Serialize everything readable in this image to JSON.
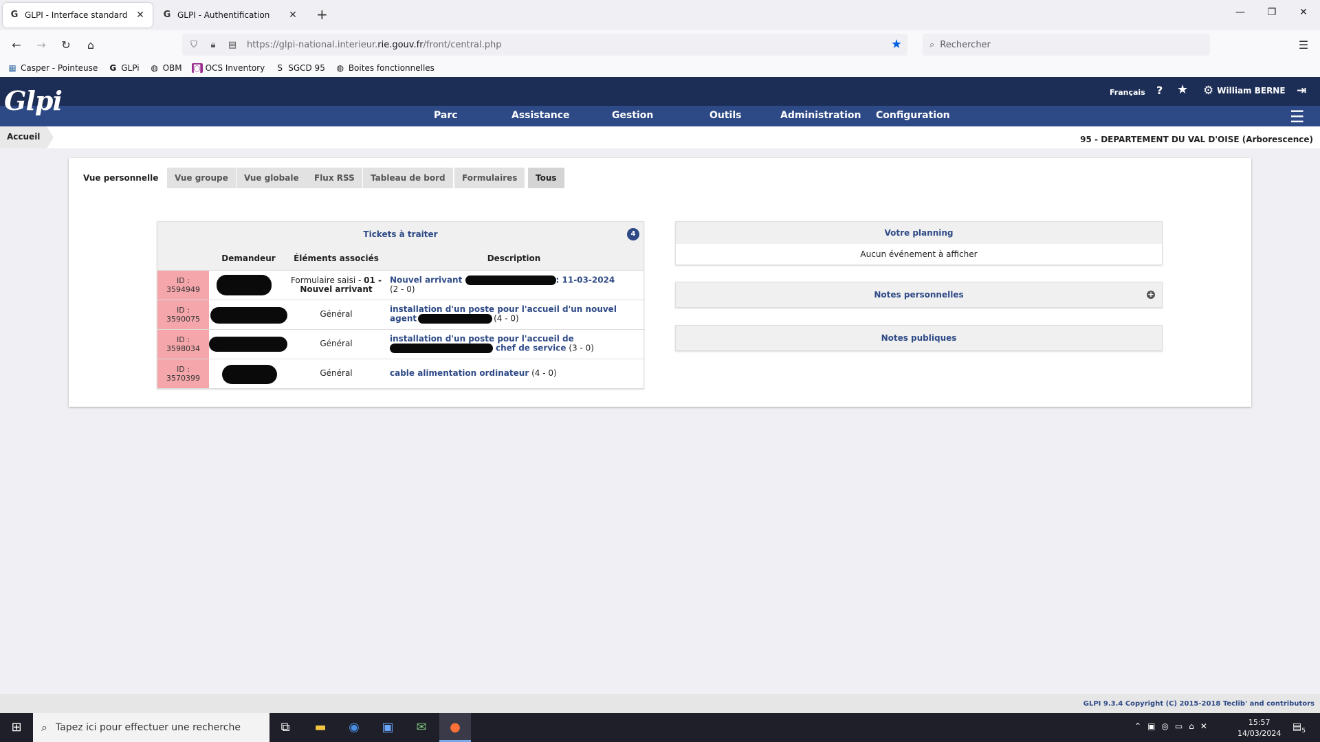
{
  "browser": {
    "tabs": [
      {
        "title": "GLPI - Interface standard",
        "favicon": "G"
      },
      {
        "title": "GLPI - Authentification",
        "favicon": "G"
      }
    ],
    "new_tab": "+",
    "url_prefix": "https://glpi-national.interieur.",
    "url_domain": "rie.gouv.fr",
    "url_path": "/front/central.php",
    "search_placeholder": "Rechercher",
    "bookmarks": [
      {
        "label": "Casper - Pointeuse",
        "icon": "calendar-icon"
      },
      {
        "label": "GLPi",
        "icon": "glpi-icon"
      },
      {
        "label": "OBM",
        "icon": "globe-icon"
      },
      {
        "label": "OCS Inventory",
        "icon": "ocs-icon"
      },
      {
        "label": "SGCD 95",
        "icon": "s-icon"
      },
      {
        "label": "Boites fonctionnelles",
        "icon": "globe-icon"
      }
    ]
  },
  "glpi": {
    "logo": "Glpi",
    "language": "Français",
    "help": "?",
    "user": "William BERNE",
    "menu": [
      "Parc",
      "Assistance",
      "Gestion",
      "Outils",
      "Administration",
      "Configuration"
    ],
    "breadcrumb": "Accueil",
    "entity": "95 - DEPARTEMENT DU VAL D'OISE (Arborescence)",
    "view_tabs": [
      "Vue personnelle",
      "Vue groupe",
      "Vue globale",
      "Flux RSS",
      "Tableau de bord",
      "Formulaires",
      "Tous"
    ],
    "tickets": {
      "title": "Tickets à traiter",
      "count": "4",
      "columns": [
        "",
        "Demandeur",
        "Éléments associés",
        "Description"
      ],
      "rows": [
        {
          "id_label": "ID :",
          "id": "3594949",
          "assoc_pre": "Formulaire saisi - ",
          "assoc_bold1": "01 -",
          "assoc_bold2": "Nouvel arrivant",
          "desc_link_a": "Nouvel arrivant ",
          "desc_link_b": ": 11-03-2024",
          "desc_tail": "(2 - 0)"
        },
        {
          "id_label": "ID :",
          "id": "3590075",
          "assoc": "Général",
          "desc_link_a": "installation d'un poste pour l'accueil d'un nouvel agent",
          "desc_tail": "(4 - 0)"
        },
        {
          "id_label": "ID :",
          "id": "3598034",
          "assoc": "Général",
          "desc_link_a": "installation d'un poste pour l'accueil de",
          "desc_link_b": "chef de service",
          "desc_tail": "(3 - 0)"
        },
        {
          "id_label": "ID :",
          "id": "3570399",
          "assoc": "Général",
          "desc_link_a": "cable alimentation ordinateur",
          "desc_tail": "(4 - 0)"
        }
      ]
    },
    "planning": {
      "title": "Votre planning",
      "empty": "Aucun événement à afficher"
    },
    "personal_notes": {
      "title": "Notes personnelles",
      "add": "+"
    },
    "public_notes": {
      "title": "Notes publiques"
    },
    "footer": "GLPI 9.3.4 Copyright (C) 2015-2018 Teclib' and contributors"
  },
  "taskbar": {
    "search_placeholder": "Tapez ici pour effectuer une recherche",
    "time": "15:57",
    "date": "14/03/2024",
    "notif_count": "5"
  }
}
